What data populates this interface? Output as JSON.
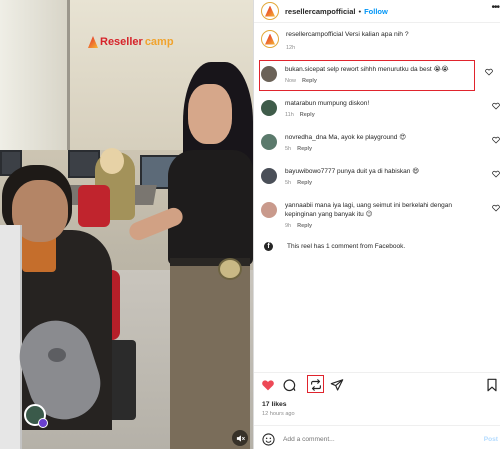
{
  "video": {
    "watermark_a": "Reseller",
    "watermark_b": "camp"
  },
  "header": {
    "username": "resellercampofficial",
    "dot": "•",
    "follow_label": "Follow",
    "more_label": "•••"
  },
  "caption": {
    "username": "resellercampofficial",
    "text": "Versi kalian apa nih ?",
    "time": "12h"
  },
  "comments": [
    {
      "username": "bukan.sicepat",
      "text": "selp rewort sihhh menurutku da best 😭😭",
      "time": "Now",
      "reply_label": "Reply",
      "avatar_color": "#6b6258"
    },
    {
      "username": "matarabun",
      "text": "mumpung diskon!",
      "time": "11h",
      "reply_label": "Reply",
      "avatar_color": "#3f5c4a"
    },
    {
      "username": "novredha_dna",
      "text": "Ma, ayok ke playground 😍",
      "time": "5h",
      "reply_label": "Reply",
      "avatar_color": "#5b7a6c"
    },
    {
      "username": "bayuwibowo7777",
      "text": "punya duit ya di habiskan 😄",
      "time": "5h",
      "reply_label": "Reply",
      "avatar_color": "#4a4f58"
    },
    {
      "username": "yannaabii",
      "text": "mana iya lagi, uang seimut ini berkelahi dengan kepinginan yang banyak itu 😉",
      "time": "9h",
      "reply_label": "Reply",
      "avatar_color": "#c99a8c"
    }
  ],
  "fb_note": {
    "icon": "f",
    "text": "This reel has 1 comment from Facebook."
  },
  "footer": {
    "likes": "17 likes",
    "posted": "12 hours ago",
    "comment_placeholder": "Add a comment...",
    "post_label": "Post"
  },
  "colors": {
    "accent_blue": "#0095f6",
    "like_red": "#ed4956",
    "highlight_red": "#e0242d"
  },
  "icons": [
    "heart-icon",
    "comment-icon",
    "repost-icon",
    "share-icon",
    "bookmark-icon",
    "emoji-icon",
    "facebook-icon",
    "mute-icon",
    "more-icon"
  ]
}
